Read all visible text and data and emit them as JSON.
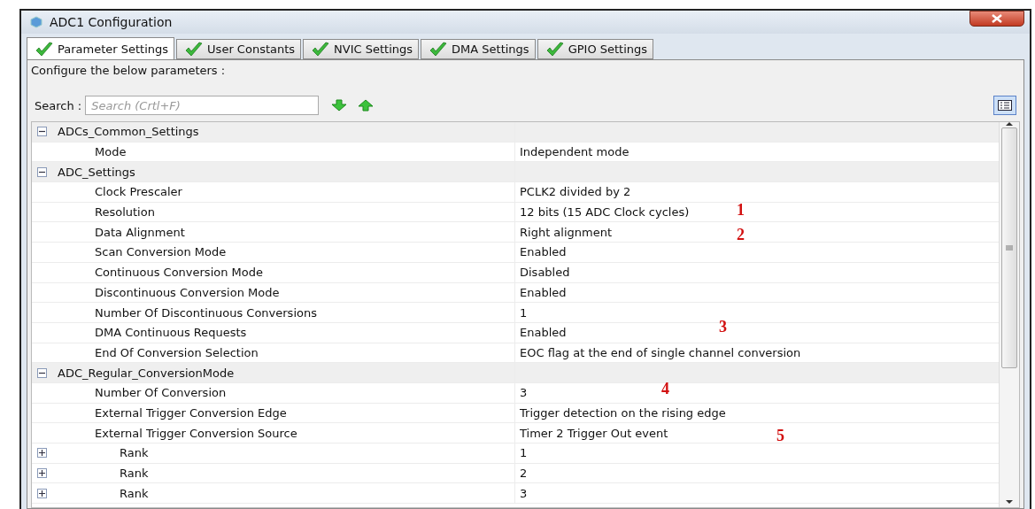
{
  "window": {
    "title": "ADC1 Configuration"
  },
  "tabs": [
    {
      "label": "Parameter Settings",
      "selected": true
    },
    {
      "label": "User Constants",
      "selected": false
    },
    {
      "label": "NVIC Settings",
      "selected": false
    },
    {
      "label": "DMA Settings",
      "selected": false
    },
    {
      "label": "GPIO Settings",
      "selected": false
    }
  ],
  "instruction": "Configure the below parameters :",
  "search": {
    "label": "Search :",
    "placeholder": "Search (Crtl+F)"
  },
  "groups": [
    {
      "name": "ADCs_Common_Settings",
      "expanded": true,
      "rows": [
        {
          "name": "Mode",
          "value": "Independent mode"
        }
      ]
    },
    {
      "name": "ADC_Settings",
      "expanded": true,
      "rows": [
        {
          "name": "Clock Prescaler",
          "value": "PCLK2 divided by 2"
        },
        {
          "name": "Resolution",
          "value": "12 bits (15 ADC Clock cycles)",
          "annotation": "1"
        },
        {
          "name": "Data Alignment",
          "value": "Right alignment",
          "annotation": "2"
        },
        {
          "name": "Scan Conversion Mode",
          "value": "Enabled"
        },
        {
          "name": "Continuous Conversion Mode",
          "value": "Disabled"
        },
        {
          "name": "Discontinuous Conversion Mode",
          "value": "Enabled"
        },
        {
          "name": "Number Of Discontinuous Conversions",
          "value": "1"
        },
        {
          "name": "DMA Continuous Requests",
          "value": "Enabled",
          "annotation": "3"
        },
        {
          "name": "End Of Conversion Selection",
          "value": "EOC flag at the end of single channel conversion"
        }
      ]
    },
    {
      "name": "ADC_Regular_ConversionMode",
      "expanded": true,
      "rows": [
        {
          "name": "Number Of Conversion",
          "value": "3",
          "annotation": "4"
        },
        {
          "name": "External Trigger Conversion Edge",
          "value": "Trigger detection on the rising edge"
        },
        {
          "name": "External Trigger Conversion Source",
          "value": "Timer 2 Trigger Out event",
          "annotation": "5"
        },
        {
          "name": "Rank",
          "value": "1",
          "expanded": false
        },
        {
          "name": "Rank",
          "value": "2",
          "expanded": false
        },
        {
          "name": "Rank",
          "value": "3",
          "expanded": false
        }
      ]
    }
  ]
}
